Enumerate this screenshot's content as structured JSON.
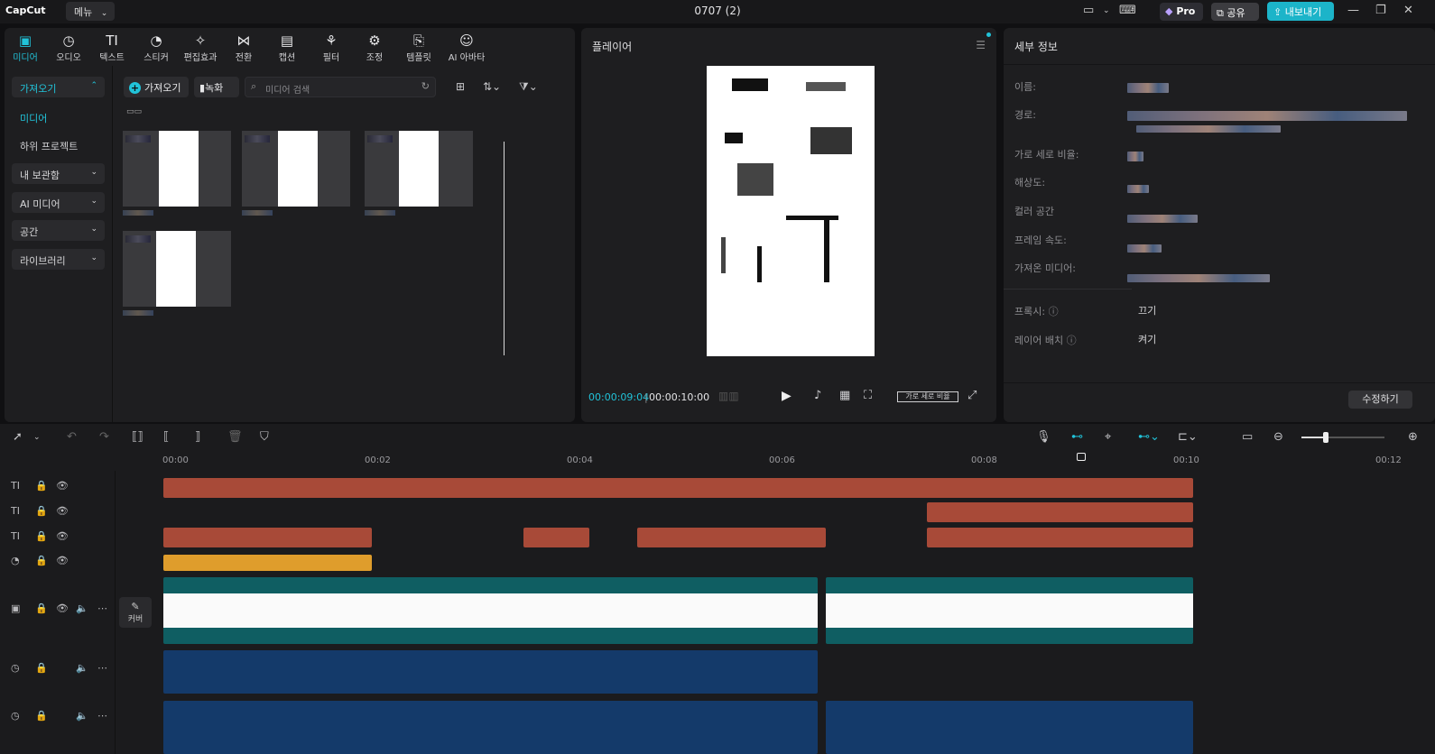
{
  "topbar": {
    "logo": "CapCut",
    "menu": "메뉴",
    "title": "0707 (2)",
    "pro": "Pro",
    "share": "공유",
    "export": "내보내기"
  },
  "tabs": [
    {
      "label": "미디어",
      "icon": "media-icon"
    },
    {
      "label": "오디오",
      "icon": "audio-icon"
    },
    {
      "label": "텍스트",
      "icon": "text-icon"
    },
    {
      "label": "스티커",
      "icon": "sticker-icon"
    },
    {
      "label": "편집효과",
      "icon": "effects-icon"
    },
    {
      "label": "전환",
      "icon": "transition-icon"
    },
    {
      "label": "캡션",
      "icon": "caption-icon"
    },
    {
      "label": "필터",
      "icon": "filter-icon"
    },
    {
      "label": "조정",
      "icon": "adjust-icon"
    },
    {
      "label": "템플릿",
      "icon": "template-icon"
    },
    {
      "label": "AI 아바타",
      "icon": "ai-avatar-icon"
    }
  ],
  "leftnav": {
    "import_group": "가져오기",
    "media": "미디어",
    "subproject": "하위 프로젝트",
    "my_storage": "내 보관함",
    "ai_media": "AI 미디어",
    "space": "공간",
    "library": "라이브러리"
  },
  "media_toolbar": {
    "import": "가져오기",
    "record": "녹화",
    "search_placeholder": "미디어 검색"
  },
  "player": {
    "title": "플레이어",
    "current_time": "00:00:09:04",
    "total_time": "00:00:10:00",
    "ratio": "가로 세로 비율"
  },
  "details": {
    "title": "세부 정보",
    "labels": {
      "name": "이름:",
      "path": "경로:",
      "aspect": "가로 세로 비율:",
      "resolution": "해상도:",
      "color_space": "컬러 공간",
      "frame_rate": "프레임 속도:",
      "imported": "가져온 미디어:",
      "proxy": "프록시:",
      "layer": "레이어 배치"
    },
    "proxy_value": "끄기",
    "layer_value": "켜기",
    "edit_button": "수정하기"
  },
  "timeline": {
    "cover": "커버",
    "ruler_labels": [
      "00:00",
      "00:02",
      "00:04",
      "00:06",
      "00:08",
      "00:10",
      "00:12"
    ]
  },
  "colors": {
    "accent": "#21c3d9",
    "text_clip": "#a84a38",
    "sticker_clip": "#df9d2c",
    "video_clip": "#0f5e62",
    "audio_clip": "#143a6a"
  }
}
